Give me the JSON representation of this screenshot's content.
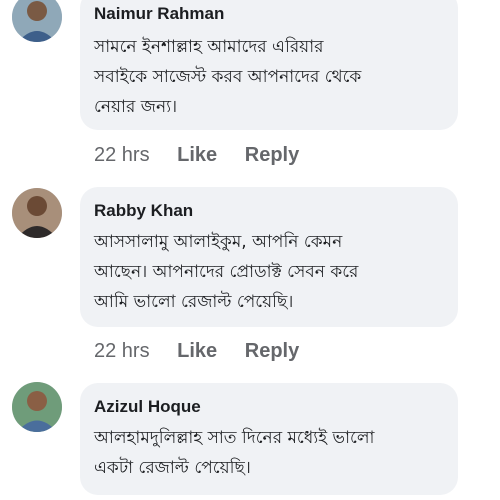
{
  "comments": [
    {
      "name": "Naimur Rahman",
      "lines": [
        "সামনে ইনশাল্লাহ আমাদের এরিয়ার",
        "সবাইকে সাজেস্ট করব আপনাদের থেকে",
        "নেয়ার জন্য।"
      ],
      "time": "22 hrs",
      "like": "Like",
      "reply": "Reply"
    },
    {
      "name": "Rabby Khan",
      "lines": [
        "আসসালামু আলাইকুম, আপনি কেমন",
        "আছেন। আপনাদের প্রোডাক্ট সেবন করে",
        "আমি ভালো রেজাল্ট পেয়েছি।"
      ],
      "time": "22 hrs",
      "like": "Like",
      "reply": "Reply"
    },
    {
      "name": "Azizul Hoque",
      "lines": [
        "আলহামদুলিল্লাহ সাত দিনের মধ্যেই ভালো",
        "একটা রেজাল্ট পেয়েছি।"
      ]
    }
  ]
}
